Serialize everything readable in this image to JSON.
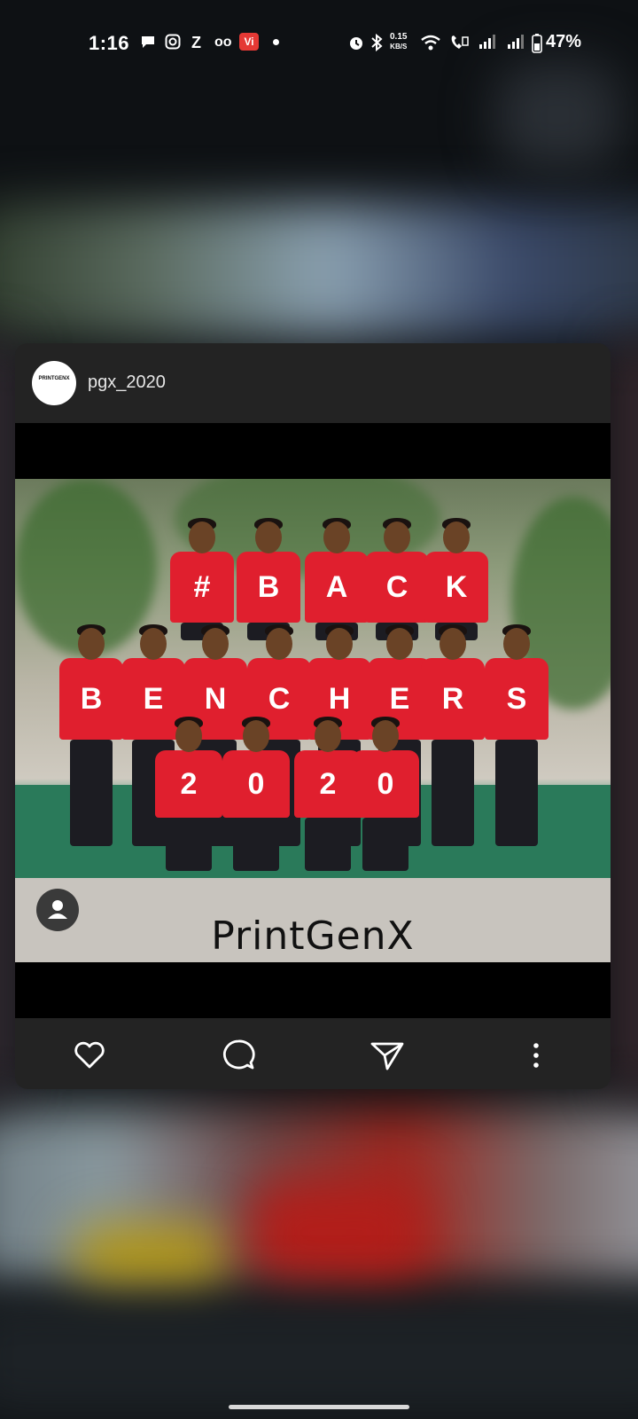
{
  "status_bar": {
    "time": "1:16",
    "vi_badge": "Vi",
    "net_speed_value": "0.15",
    "net_speed_unit": "KB/S",
    "battery": "47%",
    "notif_z": "Z",
    "notif_oo": "oo"
  },
  "post": {
    "username": "pgx_2020",
    "avatar_text": "PRINTGENX",
    "image": {
      "brand_text": "PrintGenX",
      "row1_letters": [
        "#",
        "B",
        "A",
        "C",
        "K"
      ],
      "row2_letters": [
        "B",
        "E",
        "N",
        "C",
        "H",
        "E",
        "R",
        "S"
      ],
      "row3_letters": [
        "2",
        "0",
        "2",
        "0"
      ]
    }
  },
  "actions": [
    "like-icon",
    "comment-icon",
    "share-icon",
    "more-icon"
  ]
}
